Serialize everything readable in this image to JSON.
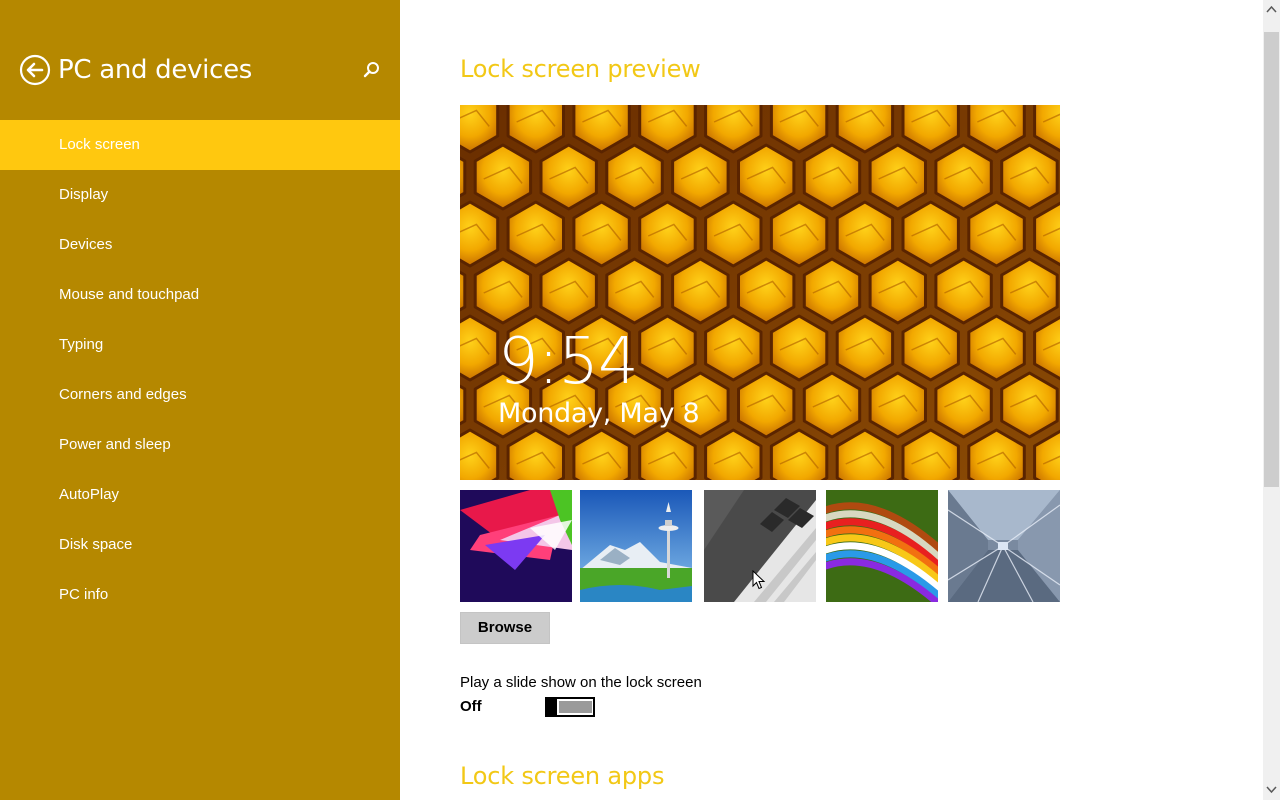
{
  "sidebar": {
    "title": "PC and devices",
    "back_icon": "back-arrow-icon",
    "search_icon": "search-icon",
    "items": [
      {
        "label": "Lock screen",
        "selected": true
      },
      {
        "label": "Display"
      },
      {
        "label": "Devices"
      },
      {
        "label": "Mouse and touchpad"
      },
      {
        "label": "Typing"
      },
      {
        "label": "Corners and edges"
      },
      {
        "label": "Power and sleep"
      },
      {
        "label": "AutoPlay"
      },
      {
        "label": "Disk space"
      },
      {
        "label": "PC info"
      }
    ]
  },
  "main": {
    "preview_title": "Lock screen preview",
    "preview": {
      "time": "9:54",
      "date": "Monday, May 8",
      "image": "honeycomb"
    },
    "thumbnails": [
      "colorful-triangles",
      "space-needle",
      "piano-keys",
      "colored-pencils",
      "tunnel-lines"
    ],
    "browse_label": "Browse",
    "slideshow_label": "Play a slide show on the lock screen",
    "slideshow_state": "Off",
    "apps_title": "Lock screen apps"
  },
  "colors": {
    "sidebar_bg": "#b58800",
    "selected_bg": "#ffc80f",
    "accent_title": "#f2c816"
  }
}
